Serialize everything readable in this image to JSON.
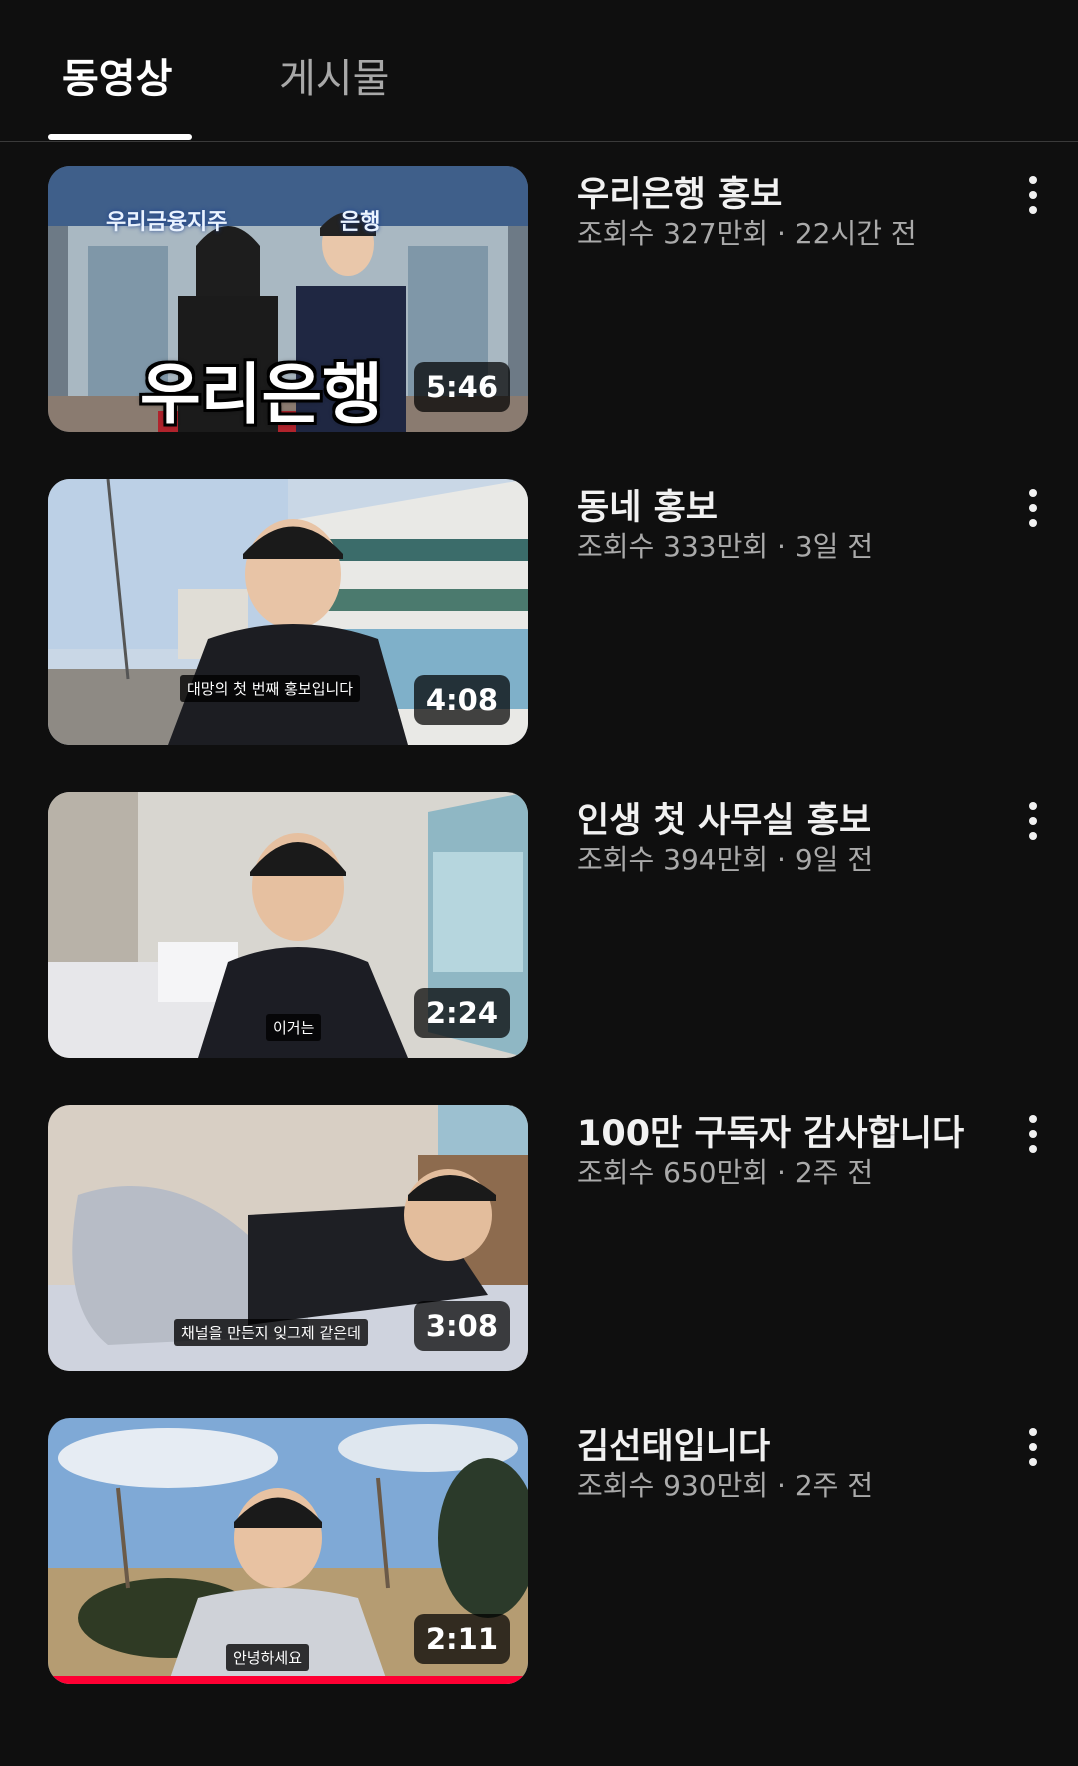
{
  "tabs": [
    {
      "label": "동영상",
      "active": true
    },
    {
      "label": "게시물",
      "active": false
    }
  ],
  "videos": [
    {
      "title": "우리은행 홍보",
      "meta": "조회수 327만회 · 22시간 전",
      "duration": "5:46",
      "overlay_title": "우리은행",
      "sign_left": "우리금융지주",
      "sign_right": "은행"
    },
    {
      "title": "동네 홍보",
      "meta": "조회수 333만회 · 3일 전",
      "duration": "4:08",
      "caption": "대망의 첫 번째 홍보입니다"
    },
    {
      "title": "인생 첫 사무실 홍보",
      "meta": "조회수 394만회 · 9일 전",
      "duration": "2:24",
      "caption": "이거는"
    },
    {
      "title": "100만 구독자 감사합니다",
      "meta": "조회수 650만회 · 2주 전",
      "duration": "3:08",
      "caption": "채널을 만든지 잊그제 같은데"
    },
    {
      "title": "김선태입니다",
      "meta": "조회수 930만회 · 2주 전",
      "duration": "2:11",
      "caption": "안녕하세요",
      "watched_progress": 1.0
    }
  ],
  "colors": {
    "background": "#0f0f0f",
    "progress": "#ff0033",
    "meta_text": "#aaaaaa"
  },
  "icons": [
    "more-vert-icon"
  ]
}
